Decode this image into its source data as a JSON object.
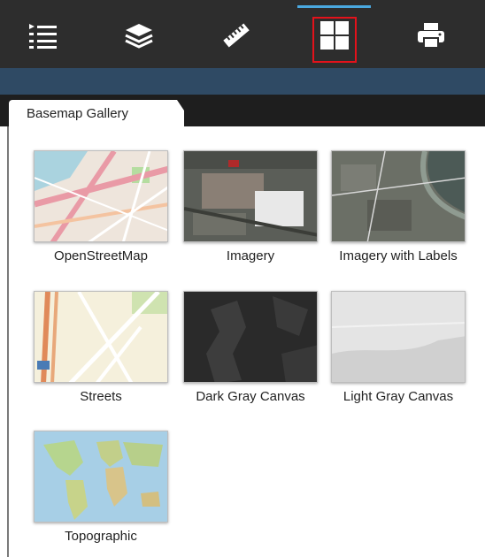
{
  "toolbar": {
    "tools": [
      {
        "name": "legend-tool",
        "icon": "list-icon"
      },
      {
        "name": "layers-tool",
        "icon": "layers-icon"
      },
      {
        "name": "measure-tool",
        "icon": "ruler-icon"
      },
      {
        "name": "basemap-gallery-tool",
        "icon": "grid-icon",
        "active": true
      },
      {
        "name": "print-tool",
        "icon": "printer-icon"
      }
    ],
    "accent_color": "#4aa8e0",
    "highlight_color": "#e3121b"
  },
  "panel": {
    "tab_label": "Basemap Gallery"
  },
  "gallery": {
    "items": [
      {
        "label": "OpenStreetMap"
      },
      {
        "label": "Imagery"
      },
      {
        "label": "Imagery with Labels"
      },
      {
        "label": "Streets"
      },
      {
        "label": "Dark Gray Canvas"
      },
      {
        "label": "Light Gray Canvas"
      },
      {
        "label": "Topographic"
      }
    ]
  }
}
